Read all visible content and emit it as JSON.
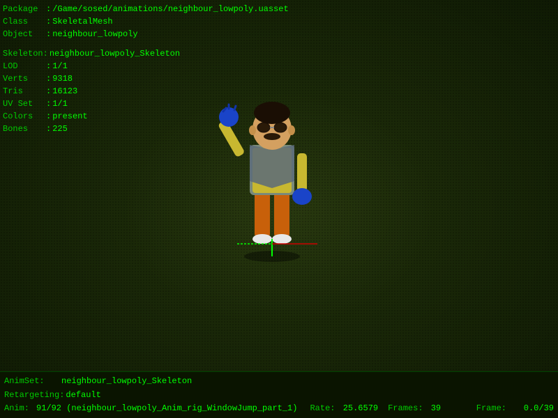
{
  "header": {
    "package_label": "Package",
    "package_value": "/Game/sosed/animations/neighbour_lowpoly.uasset",
    "class_label": "Class",
    "class_value": "SkeletalMesh",
    "object_label": "Object",
    "object_value": "neighbour_lowpoly"
  },
  "mesh_info": {
    "skeleton_label": "Skeleton:",
    "skeleton_value": "neighbour_lowpoly_Skeleton",
    "lod_label": "LOD",
    "lod_value": "1/1",
    "verts_label": "Verts",
    "verts_value": "9318",
    "tris_label": "Tris",
    "tris_value": "16123",
    "uvset_label": "UV Set",
    "uvset_value": "1/1",
    "colors_label": "Colors",
    "colors_value": "present",
    "bones_label": "Bones",
    "bones_value": "225"
  },
  "bottom": {
    "animset_label": "AnimSet:",
    "animset_value": "neighbour_lowpoly_Skeleton",
    "retargeting_label": "Retargeting:",
    "retargeting_value": "default",
    "anim_label": "Anim:",
    "anim_value": "91/92 (neighbour_lowpoly_Anim_rig_WindowJump_part_1)",
    "rate_label": "Rate:",
    "rate_value": "25.6579",
    "frames_label": "Frames:",
    "frames_value": "39",
    "frame_label": "Frame:",
    "frame_value": "0.0/39"
  }
}
